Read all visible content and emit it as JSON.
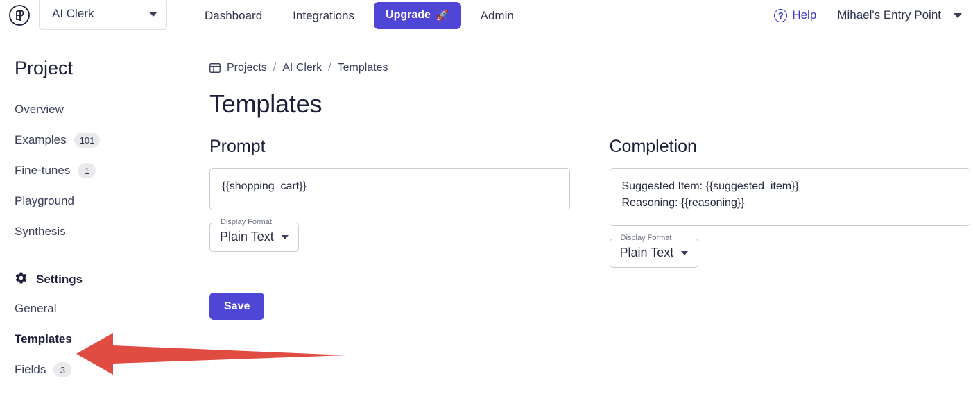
{
  "header": {
    "logo_alt": "EP",
    "project_selector": {
      "value": "AI Clerk"
    },
    "nav": [
      {
        "label": "Dashboard"
      },
      {
        "label": "Integrations"
      }
    ],
    "upgrade": {
      "label": "Upgrade",
      "icon": "🚀"
    },
    "admin": {
      "label": "Admin"
    },
    "help": {
      "label": "Help",
      "icon": "?"
    },
    "account": {
      "label": "Mihael's Entry Point"
    }
  },
  "sidebar": {
    "title": "Project",
    "items": [
      {
        "label": "Overview",
        "badge": ""
      },
      {
        "label": "Examples",
        "badge": "101"
      },
      {
        "label": "Fine-tunes",
        "badge": "1"
      },
      {
        "label": "Playground",
        "badge": ""
      },
      {
        "label": "Synthesis",
        "badge": ""
      }
    ],
    "settings_heading": "Settings",
    "settings_items": [
      {
        "label": "General",
        "badge": ""
      },
      {
        "label": "Templates",
        "badge": ""
      },
      {
        "label": "Fields",
        "badge": "3"
      }
    ]
  },
  "breadcrumb": {
    "items": [
      "Projects",
      "AI Clerk",
      "Templates"
    ],
    "separator": "/"
  },
  "main": {
    "page_title": "Templates",
    "prompt": {
      "heading": "Prompt",
      "value": "{{shopping_cart}}",
      "display_format_label": "Display Format",
      "display_format_value": "Plain Text"
    },
    "completion": {
      "heading": "Completion",
      "line1": "Suggested Item: {{suggested_item}}",
      "line2": "Reasoning: {{reasoning}}",
      "display_format_label": "Display Format",
      "display_format_value": "Plain Text"
    },
    "save_label": "Save"
  },
  "annotation": {
    "arrow_color": "#e04b42"
  },
  "colors": {
    "accent": "#4f46d6",
    "link": "#3b36c9",
    "text": "#1b1f3b",
    "badge_bg": "#eaeaec"
  }
}
